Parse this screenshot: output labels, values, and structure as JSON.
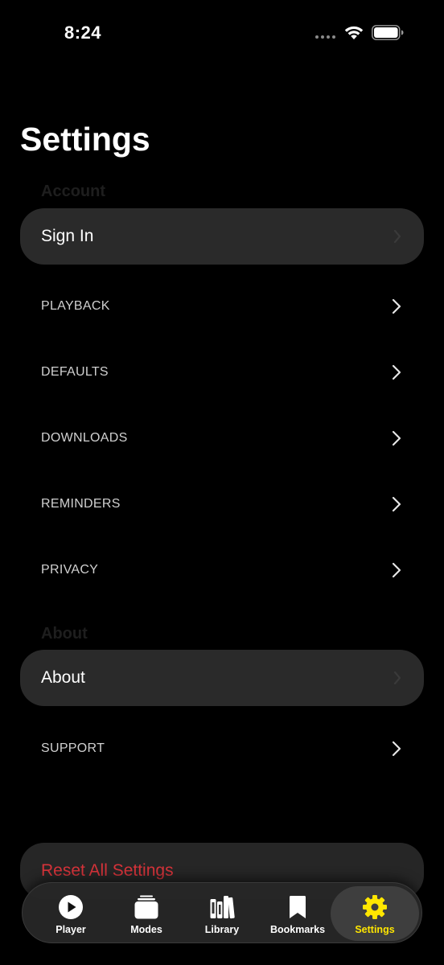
{
  "status": {
    "time": "8:24"
  },
  "title": "Settings",
  "sections": {
    "account_header": "Account",
    "about_header": "About"
  },
  "account": {
    "sign_in_label": "Sign In"
  },
  "menu": {
    "playback": "PLAYBACK",
    "defaults": "DEFAULTS",
    "downloads": "DOWNLOADS",
    "reminders": "REMINDERS",
    "privacy": "PRIVACY"
  },
  "about": {
    "about_label": "About",
    "support_label": "SUPPORT"
  },
  "reset": {
    "label": "Reset All Settings"
  },
  "tabs": [
    {
      "label": "Player",
      "icon": "play-circle-icon"
    },
    {
      "label": "Modes",
      "icon": "stack-icon"
    },
    {
      "label": "Library",
      "icon": "books-icon"
    },
    {
      "label": "Bookmarks",
      "icon": "bookmark-icon"
    },
    {
      "label": "Settings",
      "icon": "gear-icon",
      "active": true
    }
  ],
  "colors": {
    "background": "#000000",
    "card": "#2a2a2a",
    "accent": "#ffe600",
    "destructive": "#d7333a"
  }
}
